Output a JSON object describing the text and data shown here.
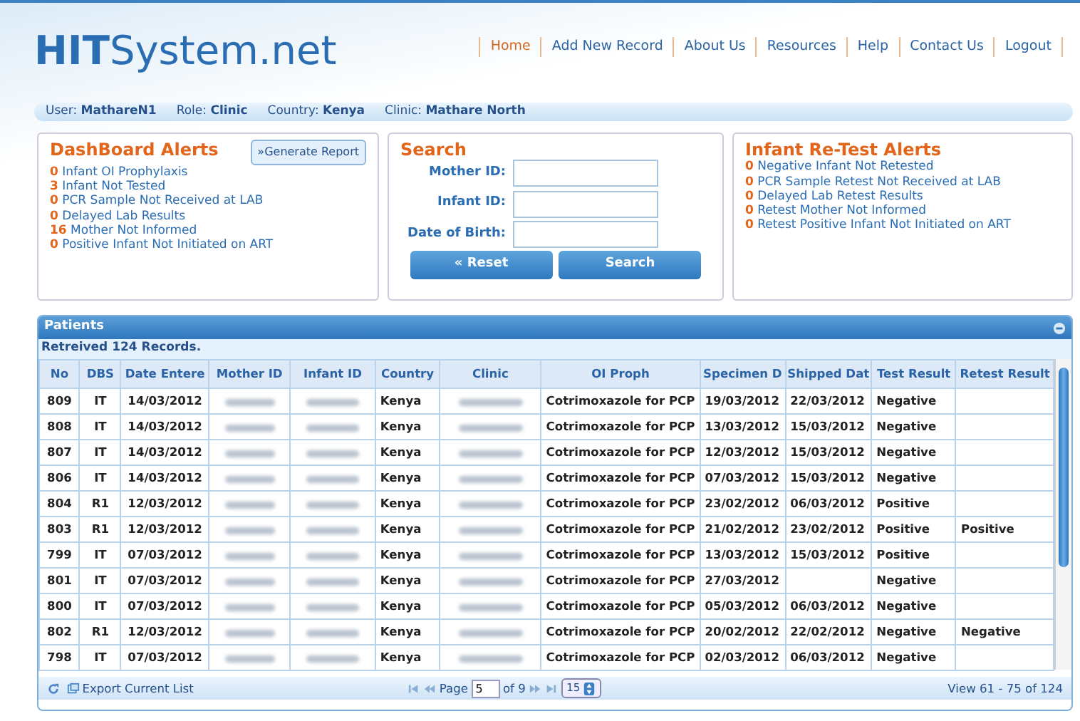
{
  "logo": {
    "bold": "HIT",
    "rest": "System.net"
  },
  "nav": [
    {
      "label": "Home",
      "selected": true
    },
    {
      "label": "Add New Record",
      "selected": false
    },
    {
      "label": "About Us",
      "selected": false
    },
    {
      "label": "Resources",
      "selected": false
    },
    {
      "label": "Help",
      "selected": false
    },
    {
      "label": "Contact Us",
      "selected": false
    },
    {
      "label": "Logout",
      "selected": false
    }
  ],
  "user_bar": [
    {
      "label": "User:",
      "value": "MathareN1"
    },
    {
      "label": "Role:",
      "value": "Clinic"
    },
    {
      "label": "Country:",
      "value": "Kenya"
    },
    {
      "label": "Clinic:",
      "value": "Mathare North"
    }
  ],
  "dashboard_alerts": {
    "title": "DashBoard Alerts",
    "button": "»Generate Report",
    "items": [
      {
        "count": "0",
        "label": "Infant OI Prophylaxis"
      },
      {
        "count": "3",
        "label": "Infant Not Tested"
      },
      {
        "count": "0",
        "label": "PCR Sample Not Received at LAB"
      },
      {
        "count": "0",
        "label": "Delayed Lab Results"
      },
      {
        "count": "16",
        "label": "Mother Not Informed"
      },
      {
        "count": "0",
        "label": "Positive Infant Not Initiated on ART"
      }
    ]
  },
  "search": {
    "title": "Search",
    "fields": [
      {
        "label": "Mother ID:"
      },
      {
        "label": "Infant ID:"
      },
      {
        "label": "Date of Birth:"
      }
    ],
    "buttons": [
      "« Reset",
      "Search"
    ]
  },
  "retest_alerts": {
    "title": "Infant Re-Test Alerts",
    "items": [
      {
        "count": "0",
        "label": "Negative Infant Not Retested"
      },
      {
        "count": "0",
        "label": "PCR Sample Retest Not Received at LAB"
      },
      {
        "count": "0",
        "label": "Delayed Lab Retest Results"
      },
      {
        "count": "0",
        "label": "Retest Mother Not Informed"
      },
      {
        "count": "0",
        "label": "Retest Positive Infant Not Initiated on ART"
      }
    ]
  },
  "patients": {
    "title": "Patients",
    "message": "Retreived 124 Records.",
    "columns": [
      {
        "label": "No",
        "redacted": false
      },
      {
        "label": "DBS",
        "redacted": false
      },
      {
        "label": "Date Entere",
        "redacted": false
      },
      {
        "label": "Mother ID",
        "redacted": true
      },
      {
        "label": "Infant ID",
        "redacted": true
      },
      {
        "label": "Country",
        "redacted": false
      },
      {
        "label": "Clinic",
        "redacted": true
      },
      {
        "label": "OI Proph",
        "redacted": false
      },
      {
        "label": "Specimen D",
        "redacted": false
      },
      {
        "label": "Shipped Dat",
        "redacted": false
      },
      {
        "label": "Test Result",
        "redacted": false
      },
      {
        "label": "Retest Result",
        "redacted": false
      }
    ],
    "rows": [
      [
        "809",
        "IT",
        "14/03/2012",
        "",
        "",
        "Kenya",
        "",
        "Cotrimoxazole for PCP",
        "19/03/2012",
        "22/03/2012",
        "Negative",
        ""
      ],
      [
        "808",
        "IT",
        "14/03/2012",
        "",
        "",
        "Kenya",
        "",
        "Cotrimoxazole for PCP",
        "13/03/2012",
        "15/03/2012",
        "Negative",
        ""
      ],
      [
        "807",
        "IT",
        "14/03/2012",
        "",
        "",
        "Kenya",
        "",
        "Cotrimoxazole for PCP",
        "12/03/2012",
        "15/03/2012",
        "Negative",
        ""
      ],
      [
        "806",
        "IT",
        "14/03/2012",
        "",
        "",
        "Kenya",
        "",
        "Cotrimoxazole for PCP",
        "07/03/2012",
        "15/03/2012",
        "Negative",
        ""
      ],
      [
        "804",
        "R1",
        "12/03/2012",
        "",
        "",
        "Kenya",
        "",
        "Cotrimoxazole for PCP",
        "23/02/2012",
        "06/03/2012",
        "Positive",
        ""
      ],
      [
        "803",
        "R1",
        "12/03/2012",
        "",
        "",
        "Kenya",
        "",
        "Cotrimoxazole for PCP",
        "21/02/2012",
        "23/02/2012",
        "Positive",
        "Positive"
      ],
      [
        "799",
        "IT",
        "07/03/2012",
        "",
        "",
        "Kenya",
        "",
        "Cotrimoxazole for PCP",
        "13/03/2012",
        "15/03/2012",
        "Positive",
        ""
      ],
      [
        "801",
        "IT",
        "07/03/2012",
        "",
        "",
        "Kenya",
        "",
        "Cotrimoxazole for PCP",
        "27/03/2012",
        "",
        "Negative",
        ""
      ],
      [
        "800",
        "IT",
        "07/03/2012",
        "",
        "",
        "Kenya",
        "",
        "Cotrimoxazole for PCP",
        "05/03/2012",
        "06/03/2012",
        "Negative",
        ""
      ],
      [
        "802",
        "R1",
        "12/03/2012",
        "",
        "",
        "Kenya",
        "",
        "Cotrimoxazole for PCP",
        "20/02/2012",
        "22/02/2012",
        "Negative",
        "Negative"
      ],
      [
        "798",
        "IT",
        "07/03/2012",
        "",
        "",
        "Kenya",
        "",
        "Cotrimoxazole for PCP",
        "02/03/2012",
        "06/03/2012",
        "Negative",
        ""
      ]
    ],
    "footer": {
      "export": "Export Current List",
      "page_label": "Page",
      "page": "5",
      "of": "of 9",
      "page_size": "15",
      "view": "View 61 - 75 of 124"
    }
  }
}
